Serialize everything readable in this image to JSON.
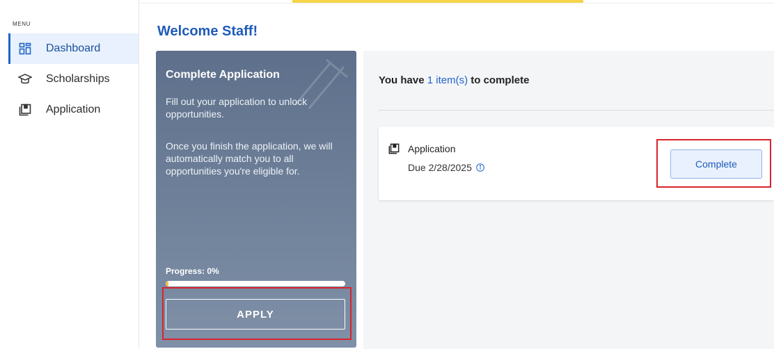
{
  "sidebar": {
    "menu_label": "MENU",
    "items": [
      {
        "label": "Dashboard",
        "icon": "dashboard-grid-icon",
        "active": true
      },
      {
        "label": "Scholarships",
        "icon": "graduation-cap-icon",
        "active": false
      },
      {
        "label": "Application",
        "icon": "application-copy-icon",
        "active": false
      }
    ]
  },
  "header": {
    "welcome": "Welcome Staff!"
  },
  "application_card": {
    "title": "Complete Application",
    "description_1": "Fill out your application to unlock opportunities.",
    "description_2": "Once you finish the application, we will automatically match you to all opportunities you're eligible for.",
    "progress_label": "Progress: 0%",
    "progress_value": 0,
    "apply_label": "APPLY"
  },
  "todo": {
    "prefix": "You have ",
    "count_text": "1 item(s)",
    "suffix": " to complete",
    "items": [
      {
        "title": "Application",
        "due": "Due 2/28/2025",
        "button_label": "Complete"
      }
    ]
  },
  "colors": {
    "accent_yellow": "#f5d547",
    "primary_blue": "#1f64c8",
    "highlight_red": "#d9232d"
  }
}
